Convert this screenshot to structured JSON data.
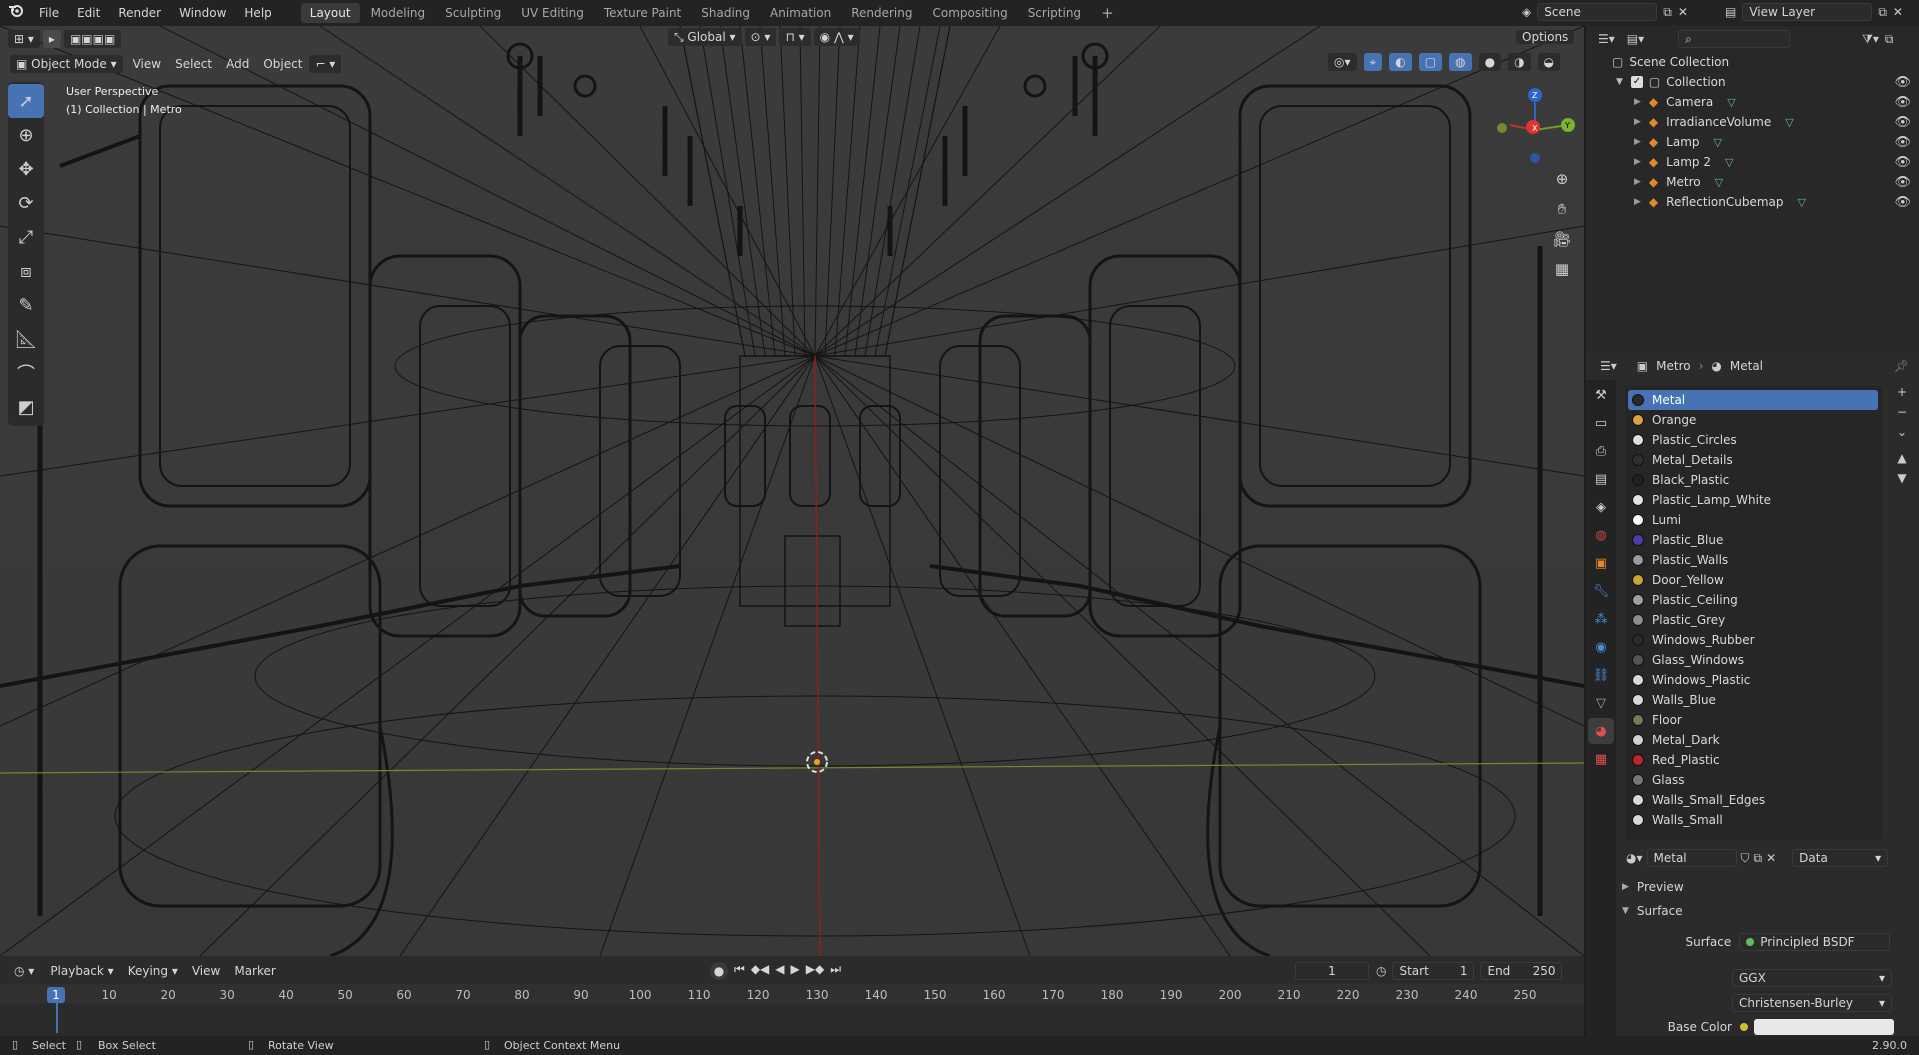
{
  "topbar": {
    "menus": [
      "File",
      "Edit",
      "Render",
      "Window",
      "Help"
    ],
    "workspaces": [
      "Layout",
      "Modeling",
      "Sculpting",
      "UV Editing",
      "Texture Paint",
      "Shading",
      "Animation",
      "Rendering",
      "Compositing",
      "Scripting"
    ],
    "active_workspace": "Layout",
    "scene": "Scene",
    "view_layer": "View Layer"
  },
  "viewport": {
    "mode": "Object Mode",
    "menus": [
      "View",
      "Select",
      "Add",
      "Object"
    ],
    "transform_orientation": "Global",
    "options_label": "Options",
    "info_line1": "User Perspective",
    "info_line2": "(1) Collection | Metro",
    "gizmo_axes": {
      "x": "X",
      "y": "Y",
      "z": "Z"
    },
    "colors": {
      "background": "#393939",
      "wire": "#0d0d0d",
      "x_axis": "#8d1f1f",
      "y_axis": "#6f8c2b",
      "accent": "#4772b3"
    }
  },
  "timeline": {
    "menus": [
      "Playback",
      "Keying",
      "View",
      "Marker"
    ],
    "current_frame": "1",
    "start_label": "Start",
    "start": "1",
    "end_label": "End",
    "end": "250",
    "ticks": [
      "1",
      "10",
      "20",
      "30",
      "40",
      "50",
      "60",
      "70",
      "80",
      "90",
      "100",
      "110",
      "120",
      "130",
      "140",
      "150",
      "160",
      "170",
      "180",
      "190",
      "200",
      "210",
      "220",
      "230",
      "240",
      "250"
    ]
  },
  "statusbar": {
    "select": "Select",
    "box_select": "Box Select",
    "rotate_view": "Rotate View",
    "context_menu": "Object Context Menu",
    "version": "2.90.0"
  },
  "outliner": {
    "root": "Scene Collection",
    "collection": "Collection",
    "items": [
      {
        "name": "Camera",
        "icon": "camera-icon"
      },
      {
        "name": "IrradianceVolume",
        "icon": "light-probe-icon"
      },
      {
        "name": "Lamp",
        "icon": "light-icon"
      },
      {
        "name": "Lamp 2",
        "icon": "light-icon"
      },
      {
        "name": "Metro",
        "icon": "mesh-icon"
      },
      {
        "name": "ReflectionCubemap",
        "icon": "light-probe-icon"
      }
    ]
  },
  "properties": {
    "breadcrumb_object": "Metro",
    "breadcrumb_material": "Metal",
    "materials": [
      {
        "name": "Metal",
        "color": "#2a2a2a",
        "active": true
      },
      {
        "name": "Orange",
        "color": "#d9a441"
      },
      {
        "name": "Plastic_Circles",
        "color": "#dedede"
      },
      {
        "name": "Metal_Details",
        "color": "#2e2e2e"
      },
      {
        "name": "Black_Plastic",
        "color": "#202020"
      },
      {
        "name": "Plastic_Lamp_White",
        "color": "#e2e2e2"
      },
      {
        "name": "Lumi",
        "color": "#ffffff"
      },
      {
        "name": "Plastic_Blue",
        "color": "#4a3fa8"
      },
      {
        "name": "Plastic_Walls",
        "color": "#9a9a9a"
      },
      {
        "name": "Door_Yellow",
        "color": "#c9a633"
      },
      {
        "name": "Plastic_Ceiling",
        "color": "#a0a0a0"
      },
      {
        "name": "Plastic_Grey",
        "color": "#8c8c8c"
      },
      {
        "name": "Windows_Rubber",
        "color": "#2a2a2a"
      },
      {
        "name": "Glass_Windows",
        "color": "#555555"
      },
      {
        "name": "Windows_Plastic",
        "color": "#d8d8d8"
      },
      {
        "name": "Walls_Blue",
        "color": "#d8d8d8"
      },
      {
        "name": "Floor",
        "color": "#6f7c56"
      },
      {
        "name": "Metal_Dark",
        "color": "#d0d0d0"
      },
      {
        "name": "Red_Plastic",
        "color": "#c0252a"
      },
      {
        "name": "Glass",
        "color": "#777777"
      },
      {
        "name": "Walls_Small_Edges",
        "color": "#d8d8d8"
      },
      {
        "name": "Walls_Small",
        "color": "#d8d8d8"
      }
    ],
    "material_name": "Metal",
    "data_dropdown": "Data",
    "panel_preview": "Preview",
    "panel_surface": "Surface",
    "surface_label": "Surface",
    "surface_value": "Principled BSDF",
    "distribution": "GGX",
    "subsurface": "Christensen-Burley",
    "base_color_label": "Base Color",
    "base_color": "#e8e8e8"
  }
}
